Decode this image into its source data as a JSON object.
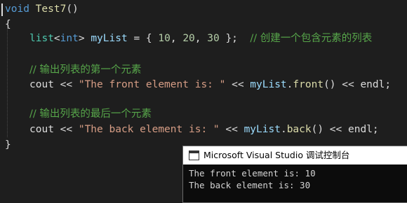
{
  "editor": {
    "line1": {
      "kw": "void",
      "fn": "Test7",
      "rest": "()"
    },
    "line2": {
      "text": "{"
    },
    "line3": {
      "type": "list",
      "lt": "<",
      "int": "int",
      "gt": ">",
      "var": "myList",
      "eq": " = { ",
      "n1": "10",
      "c1": ", ",
      "n2": "20",
      "c2": ", ",
      "n3": "30",
      "close": " };",
      "comment": "// 创建一个包含元素的列表"
    },
    "line5": {
      "comment": "// 输出列表的第一个元素"
    },
    "line6": {
      "cout": "cout",
      "op1": " << ",
      "str": "\"The front element is: \"",
      "op2": " << ",
      "var": "myList",
      "dot": ".",
      "fn": "front",
      "call": "()",
      "op3": " << ",
      "endl": "endl",
      "semi": ";"
    },
    "line8": {
      "comment": "// 输出列表的最后一个元素"
    },
    "line9": {
      "cout": "cout",
      "op1": " << ",
      "str": "\"The back element is: \"",
      "op2": " << ",
      "var": "myList",
      "dot": ".",
      "fn": "back",
      "call": "()",
      "op3": " << ",
      "endl": "endl",
      "semi": ";"
    },
    "line10": {
      "text": "}"
    }
  },
  "console": {
    "title": "Microsoft Visual Studio 调试控制台",
    "output": [
      "The front element is: 10",
      "The back element is: 30"
    ]
  },
  "icons": {
    "console": "console-window-icon"
  }
}
